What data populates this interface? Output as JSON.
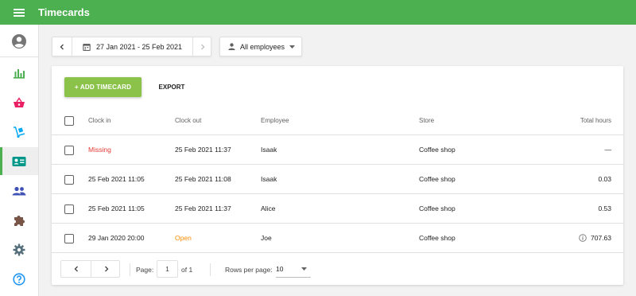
{
  "app": {
    "title": "Timecards"
  },
  "colors": {
    "appbar": "#4caf50",
    "add_button": "#8bc34a",
    "missing": "#e53935",
    "open": "#fb8c00"
  },
  "sidebar": {
    "items": [
      {
        "icon": "account-circle-icon"
      },
      {
        "icon": "bar-chart-icon"
      },
      {
        "icon": "basket-icon"
      },
      {
        "icon": "hand-truck-icon"
      },
      {
        "icon": "badge-icon",
        "active": true
      },
      {
        "icon": "people-icon"
      },
      {
        "icon": "puzzle-icon"
      },
      {
        "icon": "gear-icon"
      },
      {
        "icon": "help-icon"
      }
    ]
  },
  "filters": {
    "date_range": "27 Jan 2021 - 25 Feb 2021",
    "employee_select": "All employees"
  },
  "toolbar": {
    "add_label": "+ ADD TIMECARD",
    "export_label": "EXPORT"
  },
  "table": {
    "headers": {
      "clock_in": "Clock in",
      "clock_out": "Clock out",
      "employee": "Employee",
      "store": "Store",
      "total_hours": "Total hours"
    },
    "rows": [
      {
        "clock_in": "Missing",
        "clock_out": "25 Feb 2021 11:37",
        "employee": "Isaak",
        "store": "Coffee shop",
        "total_hours": "—"
      },
      {
        "clock_in": "25 Feb 2021 11:05",
        "clock_out": "25 Feb 2021 11:08",
        "employee": "Isaak",
        "store": "Coffee shop",
        "total_hours": "0.03"
      },
      {
        "clock_in": "25 Feb 2021 11:05",
        "clock_out": "25 Feb 2021 11:37",
        "employee": "Alice",
        "store": "Coffee shop",
        "total_hours": "0.53"
      },
      {
        "clock_in": "29 Jan 2020 20:00",
        "clock_out": "Open",
        "employee": "Joe",
        "store": "Coffee shop",
        "total_hours": "707.63"
      }
    ]
  },
  "pagination": {
    "page_label": "Page:",
    "page_value": "1",
    "of_label": "of 1",
    "rows_per_page_label": "Rows per page:",
    "rows_per_page_value": "10"
  }
}
